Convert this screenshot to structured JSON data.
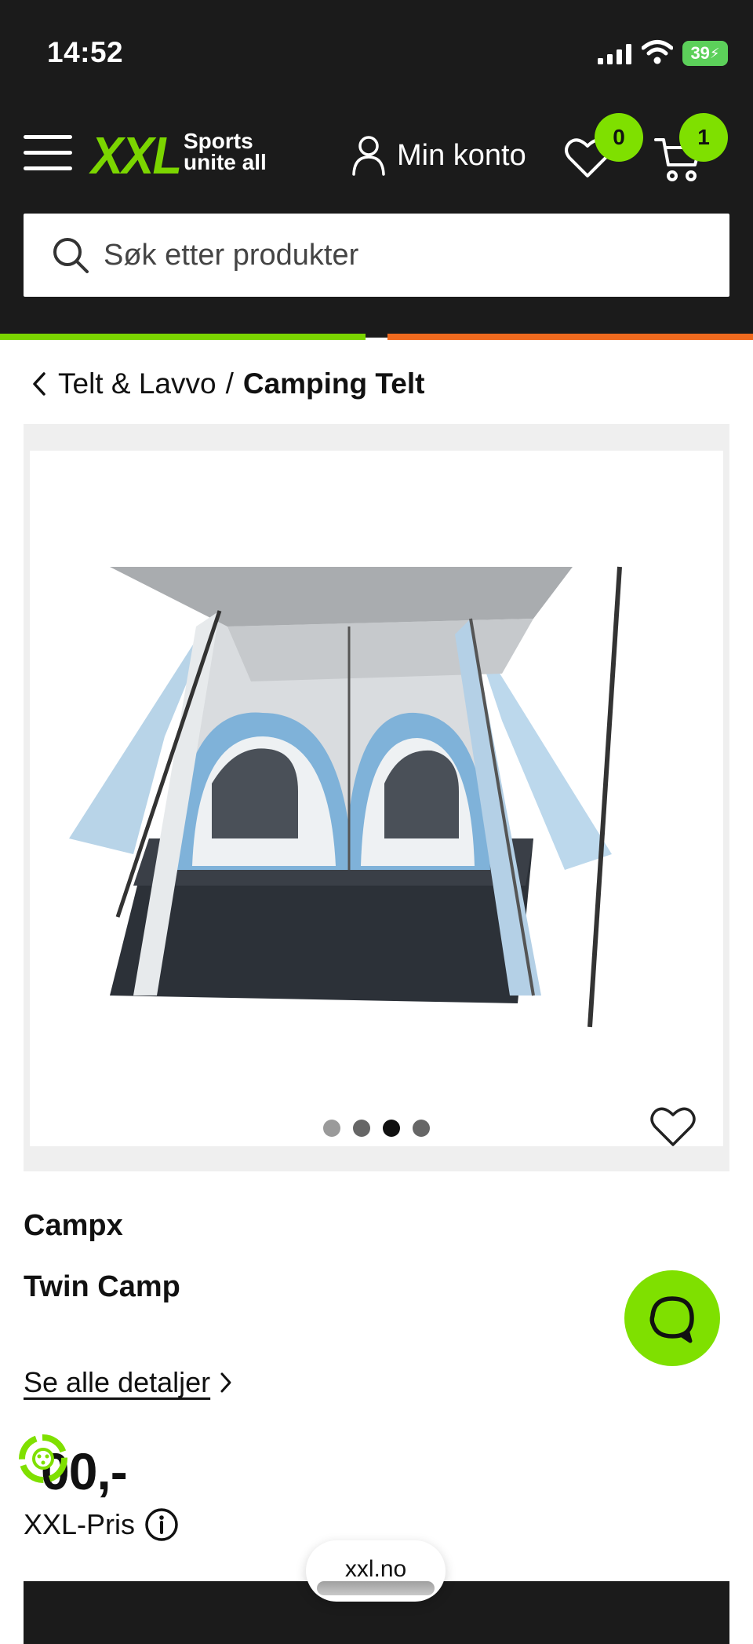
{
  "status_bar": {
    "time": "14:52",
    "battery": "39"
  },
  "header": {
    "logo": "XXL",
    "tagline_line1": "Sports",
    "tagline_line2": "unite all",
    "account_label": "Min konto",
    "wishlist_count": "0",
    "cart_count": "1",
    "search_placeholder": "Søk etter produkter"
  },
  "breadcrumb": {
    "parent": "Telt & Lavvo",
    "separator": "/",
    "current": "Camping Telt"
  },
  "gallery": {
    "slide_count": 4,
    "active_slide": 3
  },
  "product": {
    "brand": "Campx",
    "name": "Twin Camp",
    "details_link": "Se alle detaljer",
    "price": "00,-",
    "price_label": "XXL-Pris"
  },
  "browser": {
    "url": "xxl.no"
  },
  "colors": {
    "accent_green": "#7fe000",
    "header_bg": "#1b1b1b",
    "strip_orange": "#f06a1e"
  }
}
